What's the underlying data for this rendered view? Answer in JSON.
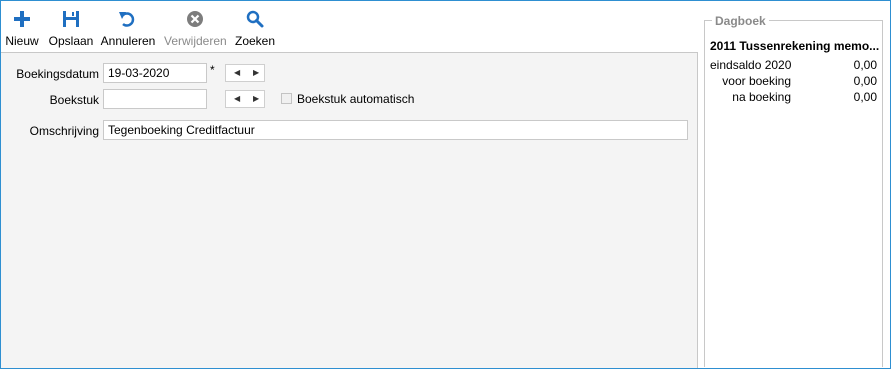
{
  "toolbar": {
    "items": [
      {
        "label": "Nieuw",
        "icon": "plus-icon",
        "enabled": true
      },
      {
        "label": "Opslaan",
        "icon": "save-icon",
        "enabled": true
      },
      {
        "label": "Annuleren",
        "icon": "undo-icon",
        "enabled": true
      },
      {
        "label": "Verwijderen",
        "icon": "delete-icon",
        "enabled": false
      },
      {
        "label": "Zoeken",
        "icon": "search-icon",
        "enabled": true
      }
    ]
  },
  "form": {
    "boekingsdatum": {
      "label": "Boekingsdatum",
      "value": "19-03-2020",
      "required_mark": "*"
    },
    "boekstuk": {
      "label": "Boekstuk",
      "value": "",
      "checkbox_label": "Boekstuk automatisch",
      "checked": false
    },
    "omschrijving": {
      "label": "Omschrijving",
      "value": "Tegenboeking Creditfactuur"
    }
  },
  "dagboek": {
    "legend": "Dagboek",
    "title": "2011 Tussenrekening memo...",
    "rows": [
      {
        "label": "eindsaldo 2020",
        "value": "0,00"
      },
      {
        "label": "voor boeking",
        "value": "0,00"
      },
      {
        "label": "na boeking",
        "value": "0,00"
      }
    ]
  },
  "colors": {
    "accent": "#1f6fc1",
    "frame": "#2e8fd1",
    "disabled": "#8a8a8a"
  }
}
